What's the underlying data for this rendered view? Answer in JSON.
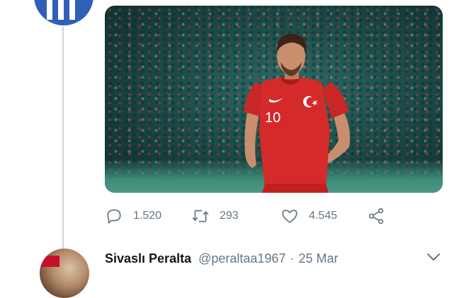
{
  "tweet": {
    "actions": {
      "replies": "1.520",
      "retweets": "293",
      "likes": "4.545"
    },
    "image": {
      "jersey_number": "10"
    }
  },
  "next_tweet": {
    "name": "Sivaslı Peralta",
    "handle": "@peraltaa1967",
    "separator": "·",
    "date": "25 Mar"
  },
  "colors": {
    "icon_gray": "#657786",
    "thread_line": "#ccd6dd",
    "avatar_blue": "#2f5fb8",
    "jersey_red": "#d42a2a"
  },
  "icons": [
    "reply-icon",
    "retweet-icon",
    "like-icon",
    "share-icon",
    "chevron-down-icon"
  ]
}
